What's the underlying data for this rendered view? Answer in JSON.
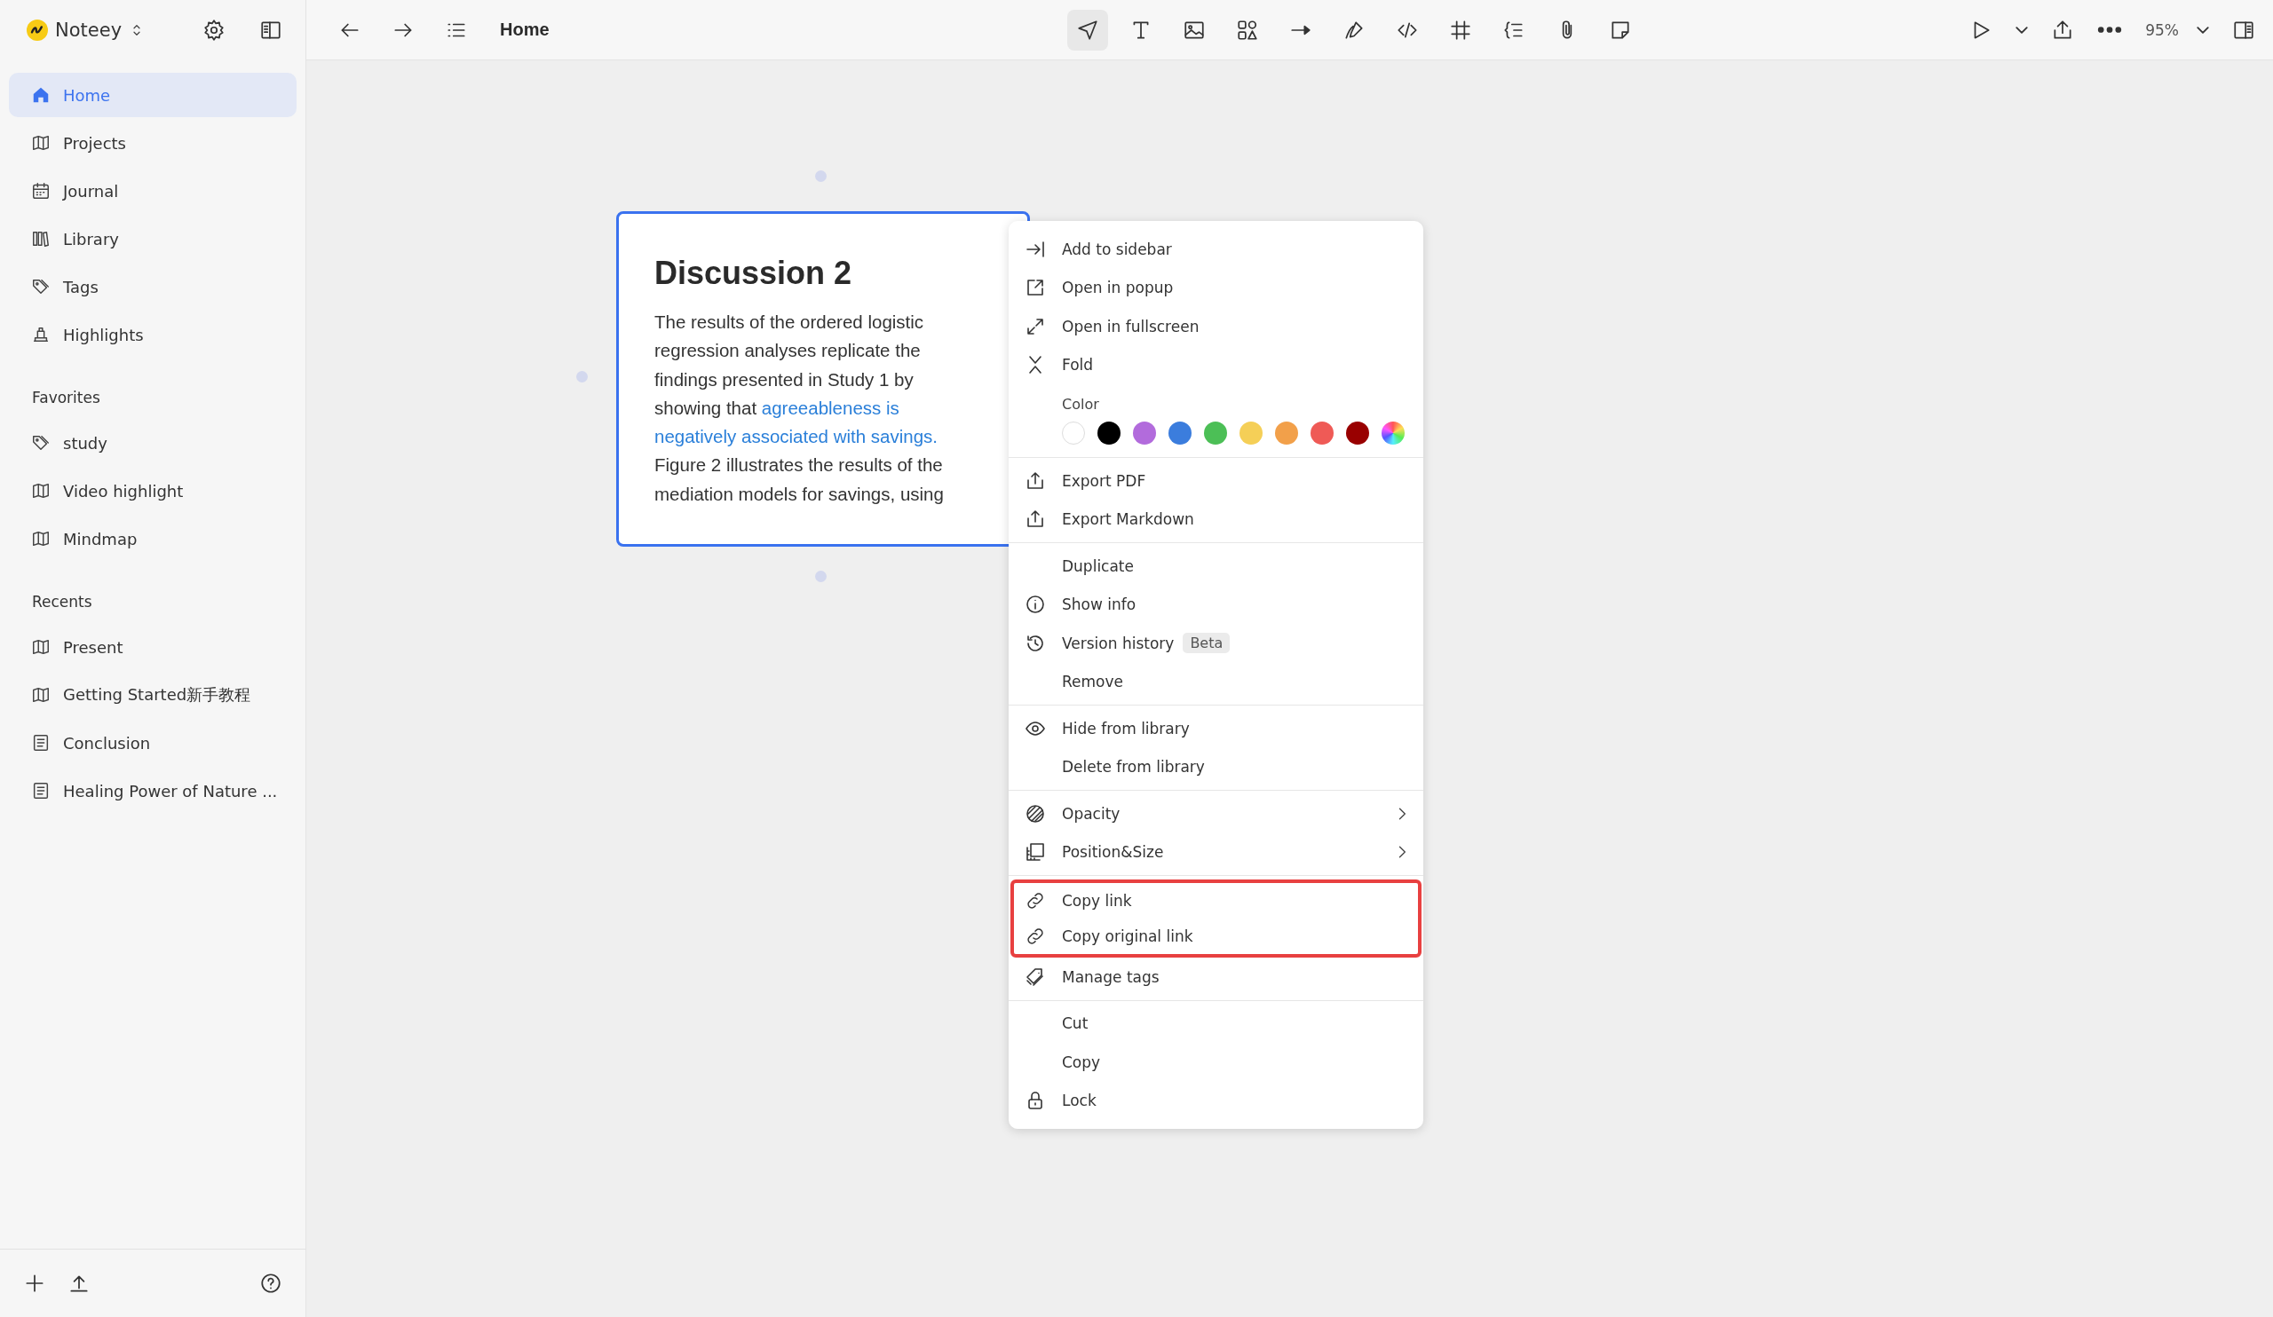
{
  "app": {
    "name": "Noteey"
  },
  "sidebar": {
    "nav": [
      {
        "label": "Home",
        "selected": true
      },
      {
        "label": "Projects",
        "selected": false
      },
      {
        "label": "Journal",
        "selected": false
      },
      {
        "label": "Library",
        "selected": false
      },
      {
        "label": "Tags",
        "selected": false
      },
      {
        "label": "Highlights",
        "selected": false
      }
    ],
    "sections": [
      {
        "title": "Favorites",
        "items": [
          {
            "label": "study",
            "kind": "tag"
          },
          {
            "label": "Video highlight",
            "kind": "board"
          },
          {
            "label": "Mindmap",
            "kind": "board"
          }
        ]
      },
      {
        "title": "Recents",
        "items": [
          {
            "label": "Present",
            "kind": "board"
          },
          {
            "label": "Getting Started新手教程",
            "kind": "board"
          },
          {
            "label": "Conclusion",
            "kind": "document"
          },
          {
            "label": "Healing Power of Nature ...",
            "kind": "document"
          }
        ]
      }
    ]
  },
  "toolbar": {
    "title": "Home",
    "tools": [
      {
        "selected": true
      },
      {
        "selected": false
      },
      {
        "selected": false
      },
      {
        "selected": false
      },
      {
        "selected": false
      },
      {
        "selected": false
      },
      {
        "selected": false
      },
      {
        "selected": false
      },
      {
        "selected": false
      },
      {
        "selected": false
      },
      {
        "selected": false
      }
    ],
    "zoom": "95%"
  },
  "card": {
    "title": "Discussion 2",
    "body": [
      {
        "text": "The results of the ordered logistic regression analyses replicate the findings presented in Study 1 by showing that ",
        "kind": "plain"
      },
      {
        "text": "agreeableness is negatively associated with savings.",
        "kind": "highlight"
      },
      {
        "text": " Figure 2 illustrates the results of the mediation models for savings, using",
        "kind": "plain"
      }
    ]
  },
  "context_menu": {
    "sections": [
      {
        "items": [
          {
            "kind": "item",
            "label": "Add to sidebar",
            "highlighted": false
          },
          {
            "kind": "item",
            "label": "Open in popup",
            "highlighted": false
          },
          {
            "kind": "item",
            "label": "Open in fullscreen",
            "highlighted": false
          },
          {
            "kind": "item",
            "label": "Fold",
            "highlighted": false
          },
          {
            "kind": "color",
            "label": "Color",
            "highlighted": false,
            "swatches": [
              {
                "color": "#ffffff"
              },
              {
                "color": "#000000"
              },
              {
                "color": "#b26bdc"
              },
              {
                "color": "#3b7ddd"
              },
              {
                "color": "#4cbf56"
              },
              {
                "color": "#f5cf57"
              },
              {
                "color": "#f2a04a"
              },
              {
                "color": "#ef5a56"
              },
              {
                "color": "#990000"
              },
              {
                "kind": "custom"
              }
            ]
          }
        ]
      },
      {
        "items": [
          {
            "kind": "item",
            "label": "Export PDF",
            "highlighted": false
          },
          {
            "kind": "item",
            "label": "Export Markdown",
            "highlighted": false
          }
        ]
      },
      {
        "items": [
          {
            "kind": "item",
            "label": "Duplicate",
            "highlighted": false
          },
          {
            "kind": "item",
            "label": "Show info",
            "highlighted": false
          },
          {
            "kind": "item",
            "label": "Version history",
            "badge": "Beta",
            "highlighted": false
          },
          {
            "kind": "item",
            "label": "Remove",
            "highlighted": false
          }
        ]
      },
      {
        "items": [
          {
            "kind": "item",
            "label": "Hide from library",
            "highlighted": false
          },
          {
            "kind": "item",
            "label": "Delete from library",
            "highlighted": false
          }
        ]
      },
      {
        "items": [
          {
            "kind": "item",
            "label": "Opacity",
            "submenu": true,
            "highlighted": false
          },
          {
            "kind": "item",
            "label": "Position&Size",
            "submenu": true,
            "highlighted": false
          }
        ]
      },
      {
        "items": [
          {
            "kind": "item",
            "label": "Copy link",
            "highlighted": true
          },
          {
            "kind": "item",
            "label": "Copy original link",
            "highlighted": true
          },
          {
            "kind": "item",
            "label": "Manage tags",
            "highlighted": false
          }
        ]
      },
      {
        "items": [
          {
            "kind": "item",
            "label": "Cut",
            "highlighted": false
          },
          {
            "kind": "item",
            "label": "Copy",
            "highlighted": false
          },
          {
            "kind": "item",
            "label": "Lock",
            "highlighted": false
          }
        ]
      }
    ]
  }
}
